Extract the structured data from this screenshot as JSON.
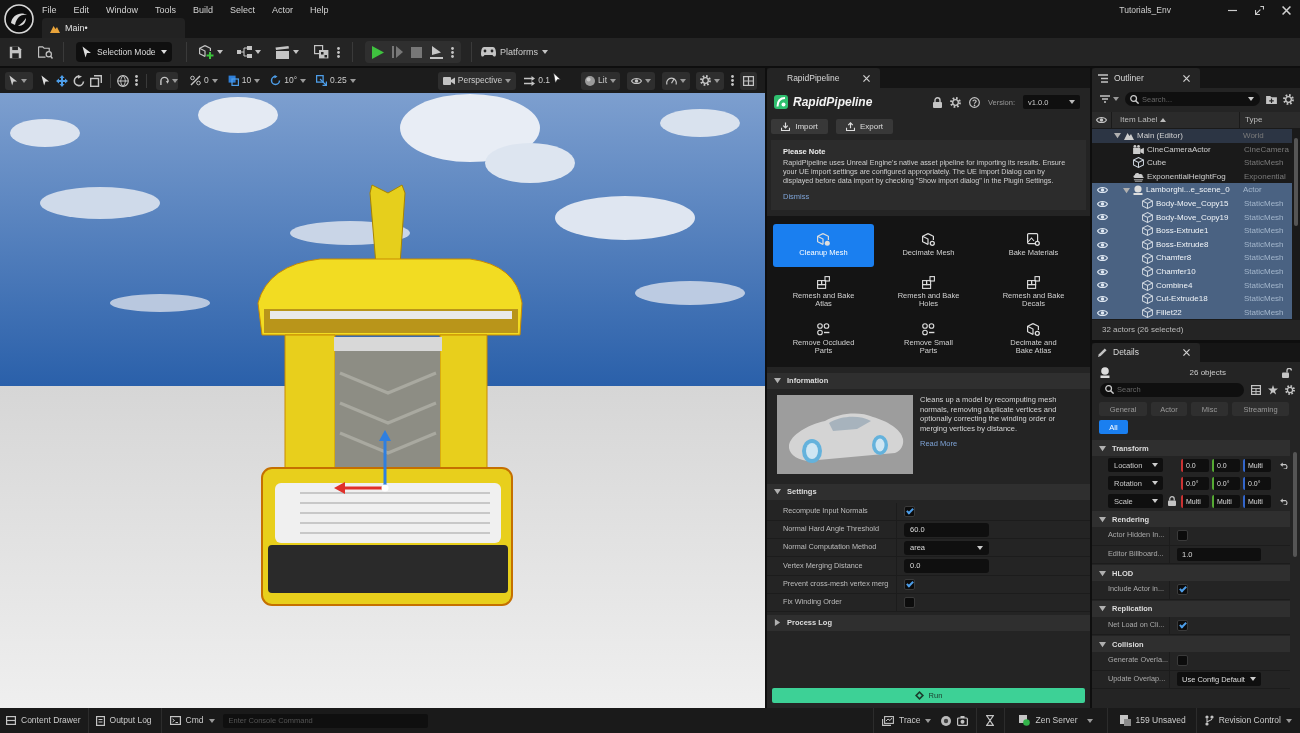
{
  "window": {
    "title": "Tutorials_Env",
    "menu": [
      "File",
      "Edit",
      "Window",
      "Tools",
      "Build",
      "Select",
      "Actor",
      "Help"
    ],
    "tabs": [
      {
        "label": "Main•",
        "selected": true
      }
    ]
  },
  "toolbar": {
    "mode": "Selection Mode",
    "platforms": "Platforms"
  },
  "viewport_toolbar": {
    "snaps": [
      "0",
      "10",
      "10°",
      "0.25"
    ],
    "projection": "Perspective",
    "camera_speed": "0.1",
    "view_mode": "Lit"
  },
  "rapid_pipeline": {
    "tab": {
      "label": "RapidPipeline",
      "selected": true
    },
    "brand": "RapidPipeline",
    "version_label": "Version:",
    "version": "v1.0.0",
    "actions": [
      "Import",
      "Export"
    ],
    "note": {
      "title": "Please Note",
      "text": "RapidPipeline uses Unreal Engine's native asset pipeline for importing its results. Ensure your UE import settings are configured appropriately. The UE Import Dialog can by displayed before data import by checking \"Show import dialog\" in the Plugin Settings.",
      "dismiss": "Dismiss"
    },
    "tools": [
      {
        "label": "Cleanup Mesh",
        "selected": true
      },
      {
        "label": "Decimate Mesh",
        "selected": false
      },
      {
        "label": "Bake Materials",
        "selected": false
      },
      {
        "label": "Remesh and Bake Atlas",
        "selected": false
      },
      {
        "label": "Remesh and Bake Holes",
        "selected": false
      },
      {
        "label": "Remesh and Bake Decals",
        "selected": false
      },
      {
        "label": "Remove Occluded Parts",
        "selected": false
      },
      {
        "label": "Remove Small Parts",
        "selected": false
      },
      {
        "label": "Decimate and Bake Atlas",
        "selected": false
      }
    ],
    "information": {
      "title": "Information",
      "expanded": true,
      "text": "Cleans up a model by recomputing mesh normals, removing duplicate vertices and optionally correcting the winding order or merging vertices by distance.",
      "link": "Read More"
    },
    "settings": {
      "title": "Settings",
      "expanded": true,
      "rows": [
        {
          "label": "Recompute Input Normals",
          "kind": "checkbox",
          "checked": true
        },
        {
          "label": "Normal Hard Angle Threshold",
          "kind": "number",
          "value": "60.0"
        },
        {
          "label": "Normal Computation Method",
          "kind": "select",
          "value": "area"
        },
        {
          "label": "Vertex Merging Distance",
          "kind": "number",
          "value": "0.0"
        },
        {
          "label": "Prevent cross-mesh vertex merg",
          "kind": "checkbox",
          "checked": true
        },
        {
          "label": "Fix Winding Order",
          "kind": "checkbox",
          "checked": false
        }
      ]
    },
    "process_log": {
      "title": "Process Log",
      "expanded": false
    },
    "run": "Run"
  },
  "outliner": {
    "tab": {
      "label": "Outliner",
      "selected": true
    },
    "search_placeholder": "Search...",
    "columns": [
      "Item Label",
      "Type"
    ],
    "tree": [
      {
        "label": "Main (Editor)",
        "type": "World",
        "kind": "world",
        "selected": false,
        "expanded": true,
        "children": [
          {
            "label": "CineCameraActor",
            "type": "CineCamera",
            "kind": "camera",
            "selected": false
          },
          {
            "label": "Cube",
            "type": "StaticMesh",
            "kind": "mesh",
            "selected": false
          },
          {
            "label": "ExponentialHeightFog",
            "type": "Exponential",
            "kind": "fog",
            "selected": false
          },
          {
            "label": "Lamborghi...e_scene_0",
            "type": "Actor",
            "kind": "actor",
            "selected": true,
            "expanded": true,
            "children": [
              {
                "label": "Body-Move_Copy15",
                "type": "StaticMesh",
                "kind": "mesh",
                "selected": true
              },
              {
                "label": "Body-Move_Copy19",
                "type": "StaticMesh",
                "kind": "mesh",
                "selected": true
              },
              {
                "label": "Boss-Extrude1",
                "type": "StaticMesh",
                "kind": "mesh",
                "selected": true
              },
              {
                "label": "Boss-Extrude8",
                "type": "StaticMesh",
                "kind": "mesh",
                "selected": true
              },
              {
                "label": "Chamfer8",
                "type": "StaticMesh",
                "kind": "mesh",
                "selected": true
              },
              {
                "label": "Chamfer10",
                "type": "StaticMesh",
                "kind": "mesh",
                "selected": true
              },
              {
                "label": "Combine4",
                "type": "StaticMesh",
                "kind": "mesh",
                "selected": true
              },
              {
                "label": "Cut-Extrude18",
                "type": "StaticMesh",
                "kind": "mesh",
                "selected": true
              },
              {
                "label": "Fillet22",
                "type": "StaticMesh",
                "kind": "mesh",
                "selected": true
              }
            ]
          }
        ]
      }
    ],
    "footer": "32 actors (26 selected)"
  },
  "details": {
    "tab": {
      "label": "Details",
      "selected": true
    },
    "summary": "26 objects",
    "search_placeholder": "Search",
    "filters": [
      {
        "label": "General",
        "selected": false
      },
      {
        "label": "Actor",
        "selected": false
      },
      {
        "label": "Misc",
        "selected": false
      },
      {
        "label": "Streaming",
        "selected": false
      },
      {
        "label": "All",
        "selected": true
      }
    ],
    "transform": {
      "title": "Transform",
      "expanded": true,
      "rows": [
        {
          "label": "Location",
          "values": [
            "0.0",
            "0.0",
            "Multi"
          ],
          "locked": false,
          "resettable": true
        },
        {
          "label": "Rotation",
          "values": [
            "0.0°",
            "0.0°",
            "0.0°"
          ],
          "locked": false,
          "resettable": false
        },
        {
          "label": "Scale",
          "values": [
            "Multi",
            "Multi",
            "Multi"
          ],
          "locked": true,
          "resettable": true
        }
      ]
    },
    "sections": [
      {
        "title": "Rendering",
        "expanded": true,
        "rows": [
          {
            "label": "Actor Hidden In...",
            "kind": "checkbox",
            "checked": false
          },
          {
            "label": "Editor Billboard...",
            "kind": "number",
            "value": "1.0"
          }
        ]
      },
      {
        "title": "HLOD",
        "expanded": true,
        "rows": [
          {
            "label": "Include Actor in...",
            "kind": "checkbox",
            "checked": true
          }
        ]
      },
      {
        "title": "Replication",
        "expanded": true,
        "rows": [
          {
            "label": "Net Load on Cli...",
            "kind": "checkbox",
            "checked": true
          }
        ]
      },
      {
        "title": "Collision",
        "expanded": true,
        "rows": [
          {
            "label": "Generate Overla...",
            "kind": "checkbox",
            "checked": false
          },
          {
            "label": "Update Overlap...",
            "kind": "select",
            "value": "Use Config Default"
          }
        ]
      }
    ]
  },
  "status_bar": {
    "content_drawer": "Content Drawer",
    "output_log": "Output Log",
    "cmd": "Cmd",
    "console_placeholder": "Enter Console Command",
    "trace": "Trace",
    "zen_server": "Zen Server",
    "unsaved": "159 Unsaved",
    "revision_control": "Revision Control"
  }
}
